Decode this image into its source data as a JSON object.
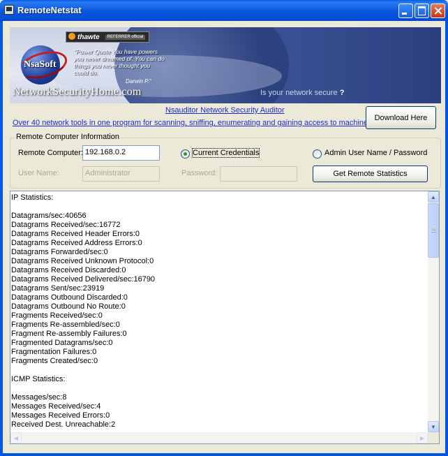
{
  "window": {
    "title": "RemoteNetstat"
  },
  "banner": {
    "badge_logo": "thawte",
    "badge_tag": "REFERRER official",
    "logo_text": "NsaSoft",
    "quote": "\"Power Quote You have powers you never dreamed of. You can do things you never thought you could do.",
    "quote_author": "Darwin P.\"",
    "site": "NetworkSecurityHome.com",
    "secure_text": "Is your network secure",
    "secure_mark": "?"
  },
  "links": {
    "auditor": "Nsauditor Network Security Auditor",
    "tools": "Over 40 network tools in one program for scanning, sniffing, enumerating and gaining access to machines."
  },
  "buttons": {
    "download": "Download Here",
    "get_stats": "Get Remote Statistics"
  },
  "remote": {
    "group_title": "Remote Computer Information",
    "computer_label": "Remote Computer:",
    "computer_value": "192.168.0.2",
    "radio_current": "Current Credentials",
    "radio_admin": "Admin User Name / Password",
    "username_label": "User Name:",
    "username_value": "Administrator",
    "password_label": "Password:",
    "password_value": ""
  },
  "output": {
    "lines": [
      "IP Statistics:",
      "",
      "Datagrams/sec:40656",
      "Datagrams Received/sec:16772",
      "Datagrams Received Header Errors:0",
      "Datagrams Received Address Errors:0",
      "Datagrams Forwarded/sec:0",
      "Datagrams Received Unknown Protocol:0",
      "Datagrams Received Discarded:0",
      "Datagrams Received Delivered/sec:16790",
      "Datagrams Sent/sec:23919",
      "Datagrams Outbound Discarded:0",
      "Datagrams Outbound No Route:0",
      "Fragments Received/sec:0",
      "Fragments Re-assembled/sec:0",
      "Fragment Re-assembly Failures:0",
      "Fragmented Datagrams/sec:0",
      "Fragmentation Failures:0",
      "Fragments Created/sec:0",
      "",
      "ICMP Statistics:",
      "",
      "Messages/sec:8",
      "Messages Received/sec:4",
      "Messages Received Errors:0",
      "Received Dest. Unreachable:2"
    ]
  },
  "icons": {
    "minimize": "minimize-icon",
    "maximize": "maximize-icon",
    "close": "close-icon",
    "scroll_up": "scroll-up-arrow-icon",
    "scroll_down": "scroll-down-arrow-icon",
    "scroll_left": "scroll-left-arrow-icon",
    "scroll_right": "scroll-right-arrow-icon"
  },
  "colors": {
    "titlebar": "#0a5fe4",
    "link": "#1a2bd6",
    "radio_dot": "#2a9a2a"
  }
}
